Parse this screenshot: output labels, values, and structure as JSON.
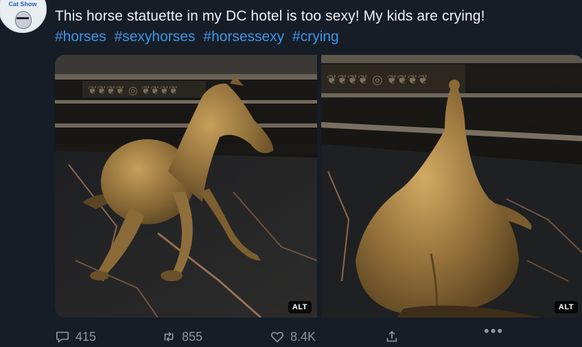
{
  "tweet": {
    "text": "This horse statuette in my DC hotel is too sexy! My kids are crying!",
    "hashtags": [
      "#horses",
      "#sexyhorses",
      "#horsessexy",
      "#crying"
    ]
  },
  "avatar": {
    "badge_text": "Cat Show"
  },
  "media": {
    "photos": [
      {
        "alt_badge": "ALT"
      },
      {
        "alt_badge": "ALT"
      }
    ]
  },
  "actions": {
    "replies": "415",
    "retweets": "855",
    "likes": "8.4K",
    "more": "•••"
  },
  "icons": {
    "reply": "speech-bubble-icon",
    "retweet": "retweet-arrows-icon",
    "like": "heart-icon",
    "share": "share-upload-icon",
    "more": "ellipsis-icon"
  }
}
